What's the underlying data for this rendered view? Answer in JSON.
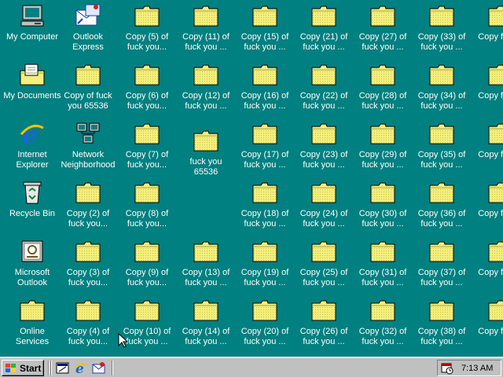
{
  "desktop": {
    "columns": [
      [
        {
          "label": "My Computer",
          "icon": "my-computer-icon"
        },
        {
          "label": "My Documents",
          "icon": "my-documents-icon"
        },
        {
          "label": "Internet Explorer",
          "icon": "internet-explorer-icon"
        },
        {
          "label": "Recycle Bin",
          "icon": "recycle-bin-icon"
        },
        {
          "label": "Microsoft Outlook",
          "icon": "outlook-icon"
        },
        {
          "label": "Online Services",
          "icon": "folder-icon"
        }
      ],
      [
        {
          "label": "Outlook Express",
          "icon": "outlook-express-icon"
        },
        {
          "label": "Copy of fuck you 65536",
          "icon": "folder-icon"
        },
        {
          "label": "Network Neighborhood",
          "icon": "network-neighborhood-icon"
        },
        {
          "label": "Copy (2) of fuck you...",
          "icon": "folder-icon"
        },
        {
          "label": "Copy (3) of fuck you...",
          "icon": "folder-icon"
        },
        {
          "label": "Copy (4) of fuck you...",
          "icon": "folder-icon"
        }
      ],
      [
        {
          "label": "Copy (5) of fuck you...",
          "icon": "folder-icon"
        },
        {
          "label": "Copy (6) of fuck you...",
          "icon": "folder-icon"
        },
        {
          "label": "Copy (7) of fuck you...",
          "icon": "folder-icon"
        },
        {
          "label": "Copy (8) of fuck you...",
          "icon": "folder-icon"
        },
        {
          "label": "Copy (9) of fuck you...",
          "icon": "folder-icon"
        },
        {
          "label": "Copy (10) of fuck you ...",
          "icon": "folder-icon"
        }
      ],
      [
        {
          "label": "Copy (11) of fuck you ...",
          "icon": "folder-icon"
        },
        {
          "label": "Copy (12) of fuck you ...",
          "icon": "folder-icon"
        },
        {
          "label": "fuck you 65536",
          "icon": "folder-icon",
          "offset": true
        },
        null,
        {
          "label": "Copy (13) of fuck you ...",
          "icon": "folder-icon"
        },
        {
          "label": "Copy (14) of fuck you ...",
          "icon": "folder-icon"
        }
      ],
      [
        {
          "label": "Copy (15) of fuck you ...",
          "icon": "folder-icon"
        },
        {
          "label": "Copy (16) of fuck you ...",
          "icon": "folder-icon"
        },
        {
          "label": "Copy (17) of fuck you ...",
          "icon": "folder-icon"
        },
        {
          "label": "Copy (18) of fuck you ...",
          "icon": "folder-icon"
        },
        {
          "label": "Copy (19) of fuck you ...",
          "icon": "folder-icon"
        },
        {
          "label": "Copy (20) of fuck you ...",
          "icon": "folder-icon"
        }
      ],
      [
        {
          "label": "Copy (21) of fuck you ...",
          "icon": "folder-icon"
        },
        {
          "label": "Copy (22) of fuck you ...",
          "icon": "folder-icon"
        },
        {
          "label": "Copy (23) of fuck you ...",
          "icon": "folder-icon"
        },
        {
          "label": "Copy (24) of fuck you ...",
          "icon": "folder-icon"
        },
        {
          "label": "Copy (25) of fuck you ...",
          "icon": "folder-icon"
        },
        {
          "label": "Copy (26) of fuck you ...",
          "icon": "folder-icon"
        }
      ],
      [
        {
          "label": "Copy (27) of fuck you ...",
          "icon": "folder-icon"
        },
        {
          "label": "Copy (28) of fuck you ...",
          "icon": "folder-icon"
        },
        {
          "label": "Copy (29) of fuck you ...",
          "icon": "folder-icon"
        },
        {
          "label": "Copy (30) of fuck you ...",
          "icon": "folder-icon"
        },
        {
          "label": "Copy (31) of fuck you ...",
          "icon": "folder-icon"
        },
        {
          "label": "Copy (32) of fuck you ...",
          "icon": "folder-icon"
        }
      ],
      [
        {
          "label": "Copy (33) of fuck you ...",
          "icon": "folder-icon"
        },
        {
          "label": "Copy (34) of fuck you ...",
          "icon": "folder-icon"
        },
        {
          "label": "Copy (35) of fuck you ...",
          "icon": "folder-icon"
        },
        {
          "label": "Copy (36) of fuck you ...",
          "icon": "folder-icon"
        },
        {
          "label": "Copy (37) of fuck you ...",
          "icon": "folder-icon"
        },
        {
          "label": "Copy (38) of fuck you ...",
          "icon": "folder-icon"
        }
      ],
      [
        {
          "label": "Copy fuck y",
          "icon": "folder-icon"
        },
        {
          "label": "Copy fuck y",
          "icon": "folder-icon"
        },
        {
          "label": "Copy fuck y",
          "icon": "folder-icon"
        },
        {
          "label": "Copy fuck y",
          "icon": "folder-icon"
        },
        {
          "label": "Copy fuck y",
          "icon": "folder-icon"
        },
        {
          "label": "Copy fuck y",
          "icon": "folder-icon"
        }
      ]
    ]
  },
  "taskbar": {
    "start_label": "Start",
    "quick_launch": [
      "show-desktop-icon",
      "internet-explorer-icon",
      "outlook-express-icon"
    ],
    "tray_icon": "scheduler-icon",
    "clock": "7:13 AM"
  },
  "colors": {
    "desktop_bg": "#008080",
    "folder_fill": "#f3ef7a",
    "taskbar_bg": "#c0c0c0"
  }
}
